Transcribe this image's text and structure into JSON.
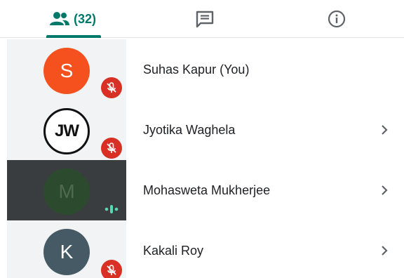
{
  "tabs": {
    "people": {
      "icon": "people-icon",
      "count": "(32)"
    },
    "chat": {
      "icon": "chat-icon"
    },
    "info": {
      "icon": "info-icon"
    }
  },
  "participants": [
    {
      "initials": "S",
      "name": "Suhas Kapur (You)",
      "status": "muted"
    },
    {
      "initials": "JW",
      "name": "Jyotika Waghela",
      "status": "muted"
    },
    {
      "initials": "M",
      "name": "Mohasweta Mukherjee",
      "status": "speaking"
    },
    {
      "initials": "K",
      "name": "Kakali Roy",
      "status": "muted"
    }
  ],
  "colors": {
    "accent": "#00796b",
    "mute_red": "#d93025",
    "speaking_green": "#5bd6b0",
    "avatar_s": "#f4511e",
    "avatar_m": "#2c4a2e",
    "avatar_k": "#455a64"
  }
}
